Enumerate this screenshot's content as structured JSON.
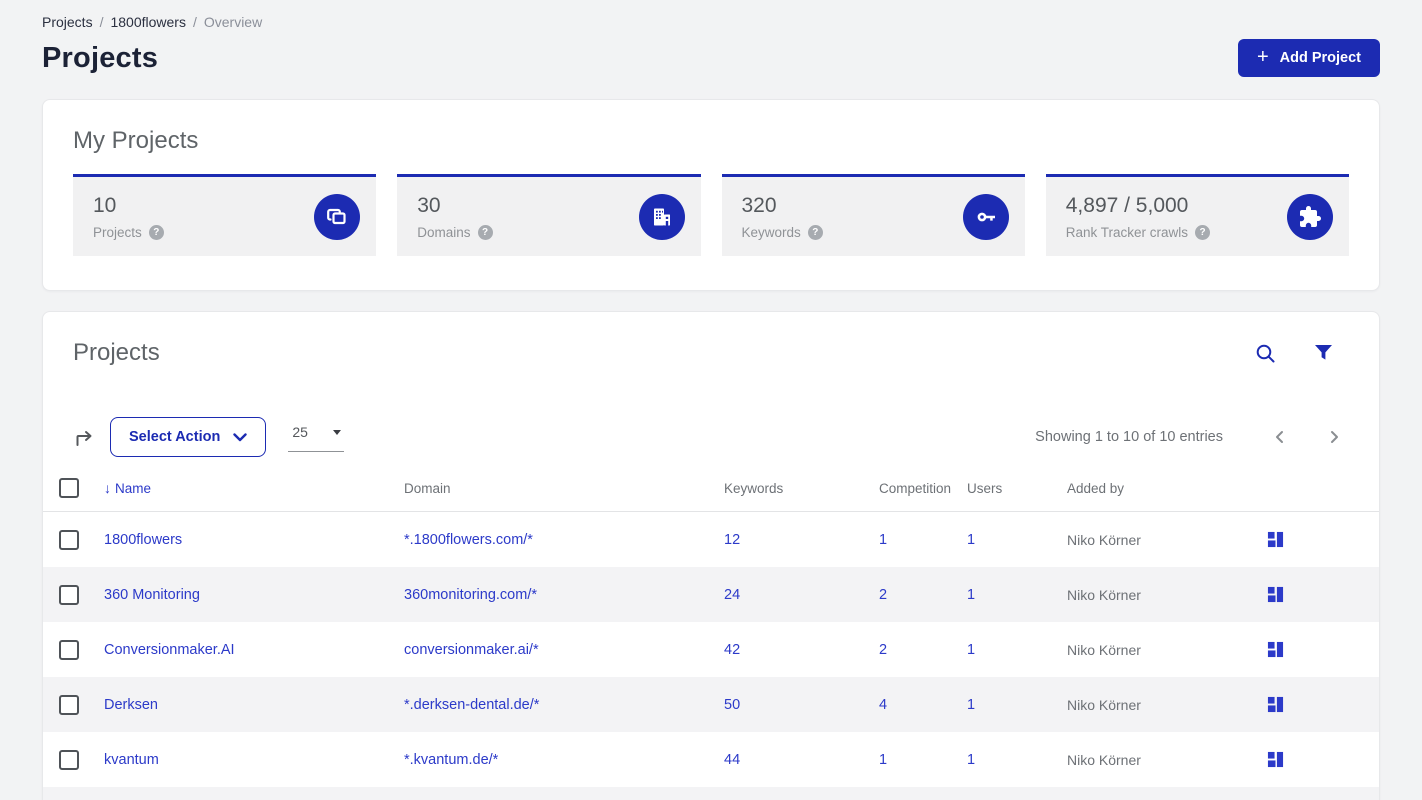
{
  "colors": {
    "brand": "#1c2bb2",
    "link": "#2c3ac9"
  },
  "breadcrumb": {
    "separator": "/",
    "items": [
      "Projects",
      "1800flowers",
      "Overview"
    ]
  },
  "page": {
    "title": "Projects"
  },
  "header": {
    "add_project_label": "Add Project",
    "plus_glyph": "+",
    "help_glyph": "?"
  },
  "my_projects": {
    "title": "My Projects",
    "stats": [
      {
        "value": "10",
        "label": "Projects",
        "icon": "projects-copy-icon"
      },
      {
        "value": "30",
        "label": "Domains",
        "icon": "building-icon"
      },
      {
        "value": "320",
        "label": "Keywords",
        "icon": "key-icon"
      },
      {
        "value": "4,897 / 5,000",
        "label": "Rank Tracker crawls",
        "icon": "puzzle-icon"
      }
    ]
  },
  "projects_panel": {
    "title": "Projects",
    "toolbar": {
      "select_action_label": "Select Action",
      "page_size": "25",
      "showing_text": "Showing 1 to 10 of 10 entries"
    },
    "table": {
      "sort_indicator": "↓",
      "headers": [
        "Name",
        "Domain",
        "Keywords",
        "Competition",
        "Users",
        "Added by"
      ],
      "rows": [
        {
          "name": "1800flowers",
          "domain": "*.1800flowers.com/*",
          "keywords": "12",
          "competition": "1",
          "users": "1",
          "added_by": "Niko Körner"
        },
        {
          "name": "360 Monitoring",
          "domain": "360monitoring.com/*",
          "keywords": "24",
          "competition": "2",
          "users": "1",
          "added_by": "Niko Körner"
        },
        {
          "name": "Conversionmaker.AI",
          "domain": "conversionmaker.ai/*",
          "keywords": "42",
          "competition": "2",
          "users": "1",
          "added_by": "Niko Körner"
        },
        {
          "name": "Derksen",
          "domain": "*.derksen-dental.de/*",
          "keywords": "50",
          "competition": "4",
          "users": "1",
          "added_by": "Niko Körner"
        },
        {
          "name": "kvantum",
          "domain": "*.kvantum.de/*",
          "keywords": "44",
          "competition": "1",
          "users": "1",
          "added_by": "Niko Körner"
        }
      ]
    }
  }
}
